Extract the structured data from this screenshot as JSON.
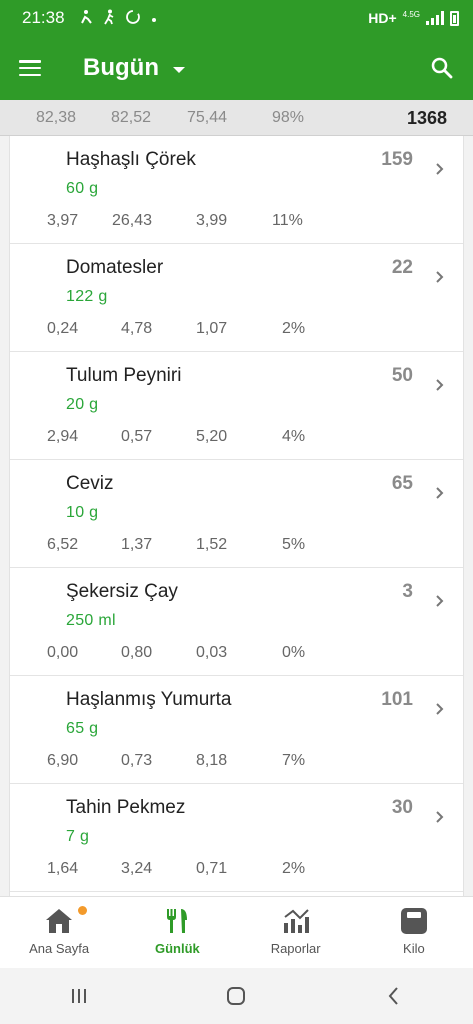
{
  "status": {
    "time": "21:38",
    "network": "HD+",
    "network_sub": "4.5G"
  },
  "appbar": {
    "title": "Bugün"
  },
  "summary": {
    "values": [
      "82,38",
      "82,52",
      "75,44",
      "98%"
    ],
    "total": "1368"
  },
  "items": [
    {
      "name": "Haşhaşlı Çörek",
      "amount": "60  g",
      "calories": "159",
      "macros": [
        "3,97",
        "26,43",
        "3,99",
        "11%"
      ]
    },
    {
      "name": "Domatesler",
      "amount": "122  g",
      "calories": "22",
      "macros": [
        "0,24",
        "4,78",
        "1,07",
        "2%"
      ]
    },
    {
      "name": "Tulum Peyniri",
      "amount": "20 g",
      "calories": "50",
      "macros": [
        "2,94",
        "0,57",
        "5,20",
        "4%"
      ]
    },
    {
      "name": "Ceviz",
      "amount": "10 g",
      "calories": "65",
      "macros": [
        "6,52",
        "1,37",
        "1,52",
        "5%"
      ]
    },
    {
      "name": "Şekersiz Çay",
      "amount": "250 ml",
      "calories": "3",
      "macros": [
        "0,00",
        "0,80",
        "0,03",
        "0%"
      ]
    },
    {
      "name": "Haşlanmış Yumurta",
      "amount": "65  g",
      "calories": "101",
      "macros": [
        "6,90",
        "0,73",
        "8,18",
        "7%"
      ]
    },
    {
      "name": "Tahin Pekmez",
      "amount": "7  g",
      "calories": "30",
      "macros": [
        "1,64",
        "3,24",
        "0,71",
        "2%"
      ]
    }
  ],
  "nav": [
    {
      "label": "Ana Sayfa",
      "icon": "home-icon"
    },
    {
      "label": "Günlük",
      "icon": "fork-knife-icon"
    },
    {
      "label": "Raporlar",
      "icon": "chart-icon"
    },
    {
      "label": "Kilo",
      "icon": "scale-icon"
    }
  ],
  "colors": {
    "primary": "#2f9b28",
    "amount": "#2aa639",
    "badge": "#f39a2b"
  }
}
